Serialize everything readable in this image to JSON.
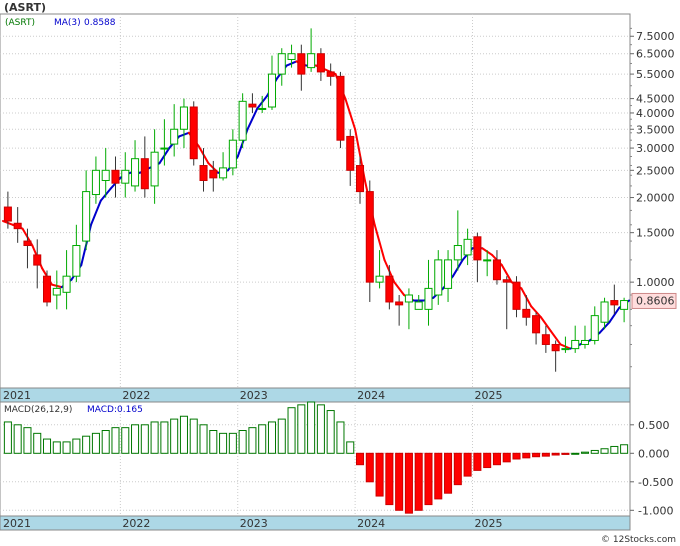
{
  "page": {
    "watermark": "© 12Stocks.com"
  },
  "chart_data": [
    {
      "type": "candlestick",
      "panel": "price",
      "ticker_label": "(ASRT)",
      "ma_label": "MA(3)",
      "ma_value": "0.8588",
      "scale": "log",
      "ylim": [
        0.42,
        9.0
      ],
      "y_ticks": [
        "7.5000",
        "6.5000",
        "5.5000",
        "4.5000",
        "4.0000",
        "3.5000",
        "3.0000",
        "2.5000",
        "2.0000",
        "1.5000",
        "1.0000"
      ],
      "y_tick_values": [
        7.5,
        6.5,
        5.5,
        4.5,
        4.0,
        3.5,
        3.0,
        2.5,
        2.0,
        1.5,
        1.0
      ],
      "last_price_label": "0.8606",
      "last_price": 0.8606,
      "x_labels": [
        "2021",
        "2022",
        "2023",
        "2024",
        "2025"
      ],
      "x_label_index": [
        0,
        12,
        24,
        36,
        48
      ],
      "grid": true,
      "colors": {
        "up": "#ffffff",
        "up_outline": "#00aa00",
        "down": "#ff0000",
        "ma_up": "#0000cc",
        "ma_down": "#ff0000",
        "last_price_bg": "#ffdddd"
      },
      "candles": [
        [
          1.65,
          1.85,
          2.1,
          1.55
        ],
        [
          1.55,
          1.62,
          1.85,
          1.38
        ],
        [
          1.35,
          1.4,
          1.55,
          1.12
        ],
        [
          1.15,
          1.25,
          1.42,
          0.95
        ],
        [
          0.85,
          1.05,
          1.1,
          0.82
        ],
        [
          0.95,
          0.9,
          1.1,
          0.8
        ],
        [
          1.05,
          0.92,
          1.3,
          0.8
        ],
        [
          1.35,
          1.05,
          1.6,
          1.0
        ],
        [
          2.1,
          1.4,
          2.5,
          1.3
        ],
        [
          2.5,
          2.05,
          2.8,
          1.9
        ],
        [
          2.5,
          2.3,
          3.0,
          2.0
        ],
        [
          2.25,
          2.5,
          2.8,
          2.0
        ],
        [
          2.5,
          2.25,
          2.9,
          2.0
        ],
        [
          2.75,
          2.2,
          3.2,
          2.1
        ],
        [
          2.15,
          2.75,
          3.3,
          2.0
        ],
        [
          2.9,
          2.2,
          3.5,
          1.9
        ],
        [
          3.0,
          3.0,
          3.8,
          2.6
        ],
        [
          3.5,
          3.1,
          4.3,
          2.8
        ],
        [
          4.2,
          3.5,
          4.5,
          3.0
        ],
        [
          2.75,
          4.2,
          4.4,
          2.6
        ],
        [
          2.3,
          2.6,
          3.0,
          2.1
        ],
        [
          2.35,
          2.5,
          2.7,
          2.1
        ],
        [
          2.55,
          2.35,
          2.9,
          2.3
        ],
        [
          3.2,
          2.55,
          3.5,
          2.4
        ],
        [
          4.4,
          3.2,
          4.7,
          3.0
        ],
        [
          4.2,
          4.3,
          4.7,
          4.0
        ],
        [
          4.15,
          4.15,
          4.6,
          4.0
        ],
        [
          5.5,
          4.2,
          6.4,
          4.1
        ],
        [
          6.5,
          5.5,
          6.8,
          5.0
        ],
        [
          6.5,
          6.2,
          7.0,
          5.8
        ],
        [
          5.5,
          6.5,
          7.0,
          4.8
        ],
        [
          6.5,
          5.8,
          8.0,
          5.6
        ],
        [
          5.6,
          6.5,
          6.8,
          5.2
        ],
        [
          5.4,
          5.6,
          6.0,
          5.0
        ],
        [
          3.2,
          5.4,
          5.6,
          3.0
        ],
        [
          2.5,
          3.3,
          3.5,
          2.2
        ],
        [
          2.1,
          2.6,
          2.8,
          1.9
        ],
        [
          1.0,
          2.1,
          2.3,
          0.85
        ],
        [
          1.05,
          1.0,
          1.3,
          0.95
        ],
        [
          0.85,
          1.05,
          1.15,
          0.8
        ],
        [
          0.83,
          0.85,
          0.9,
          0.7
        ],
        [
          0.9,
          0.85,
          0.95,
          0.68
        ],
        [
          0.85,
          0.8,
          0.9,
          0.8
        ],
        [
          0.95,
          0.8,
          1.2,
          0.7
        ],
        [
          1.2,
          0.9,
          1.3,
          0.83
        ],
        [
          1.2,
          0.95,
          1.3,
          0.85
        ],
        [
          1.35,
          1.2,
          1.8,
          1.1
        ],
        [
          1.42,
          1.25,
          1.55,
          1.15
        ],
        [
          1.2,
          1.45,
          1.5,
          1.0
        ],
        [
          1.2,
          1.2,
          1.3,
          1.05
        ],
        [
          1.02,
          1.2,
          1.3,
          0.98
        ],
        [
          1.0,
          1.02,
          1.05,
          0.68
        ],
        [
          0.8,
          1.0,
          1.05,
          0.75
        ],
        [
          0.75,
          0.8,
          0.9,
          0.7
        ],
        [
          0.66,
          0.76,
          0.78,
          0.6
        ],
        [
          0.6,
          0.65,
          0.7,
          0.56
        ],
        [
          0.57,
          0.6,
          0.62,
          0.48
        ],
        [
          0.58,
          0.58,
          0.64,
          0.56
        ],
        [
          0.62,
          0.58,
          0.7,
          0.56
        ],
        [
          0.62,
          0.6,
          0.7,
          0.58
        ],
        [
          0.76,
          0.62,
          0.82,
          0.6
        ],
        [
          0.85,
          0.72,
          0.88,
          0.68
        ],
        [
          0.83,
          0.86,
          0.98,
          0.77
        ],
        [
          0.86,
          0.8,
          0.88,
          0.72
        ]
      ],
      "ma": [
        1.65,
        1.6,
        1.55,
        1.35,
        1.12,
        0.98,
        0.96,
        1.02,
        1.15,
        1.6,
        1.95,
        2.15,
        2.35,
        2.45,
        2.45,
        2.55,
        2.65,
        3.0,
        3.3,
        3.4,
        3.05,
        2.65,
        2.45,
        2.5,
        2.8,
        3.5,
        4.15,
        4.6,
        5.3,
        5.9,
        6.1,
        5.9,
        5.9,
        5.7,
        5.5,
        4.5,
        3.5,
        2.3,
        1.6,
        1.2,
        1.0,
        0.9,
        0.86,
        0.86,
        0.88,
        0.95,
        1.05,
        1.2,
        1.32,
        1.32,
        1.25,
        1.15,
        1.0,
        0.95,
        0.82,
        0.75,
        0.67,
        0.6,
        0.58,
        0.6,
        0.62,
        0.66,
        0.72,
        0.81,
        0.86
      ]
    },
    {
      "type": "bar",
      "panel": "macd",
      "label": "MACD(26,12,9)",
      "macd_label": "MACD",
      "macd_value": "0.165",
      "y_ticks": [
        "0.500",
        "0.000",
        "-0.500",
        "-1.000"
      ],
      "y_tick_values": [
        0.5,
        0.0,
        -0.5,
        -1.0
      ],
      "ylim": [
        -1.1,
        0.9
      ],
      "x_labels": [
        "2021",
        "2022",
        "2023",
        "2024",
        "2025"
      ],
      "x_label_index": [
        0,
        12,
        24,
        36,
        48
      ],
      "grid": true,
      "colors": {
        "positive": "#007700",
        "negative": "#ff0000"
      },
      "values": [
        0.55,
        0.5,
        0.45,
        0.35,
        0.25,
        0.2,
        0.2,
        0.25,
        0.3,
        0.35,
        0.4,
        0.45,
        0.45,
        0.5,
        0.5,
        0.55,
        0.55,
        0.6,
        0.65,
        0.6,
        0.5,
        0.4,
        0.35,
        0.35,
        0.4,
        0.45,
        0.5,
        0.55,
        0.6,
        0.8,
        0.85,
        0.9,
        0.85,
        0.75,
        0.55,
        0.2,
        -0.2,
        -0.5,
        -0.75,
        -0.9,
        -1.0,
        -1.05,
        -1.0,
        -0.9,
        -0.8,
        -0.7,
        -0.55,
        -0.4,
        -0.3,
        -0.25,
        -0.2,
        -0.15,
        -0.1,
        -0.08,
        -0.06,
        -0.05,
        -0.03,
        -0.02,
        0.0,
        0.02,
        0.05,
        0.08,
        0.12,
        0.15
      ]
    }
  ]
}
